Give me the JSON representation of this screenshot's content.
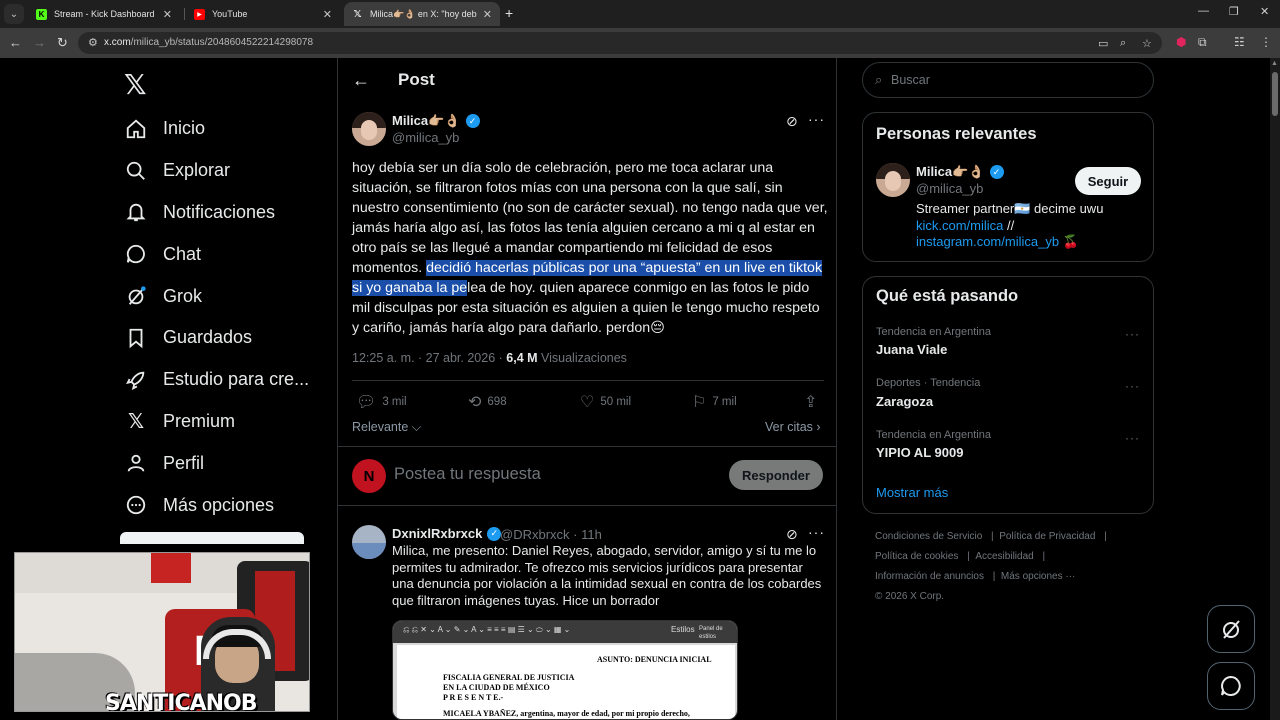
{
  "browser": {
    "tabs": [
      {
        "label": "Stream - Kick Dashboard",
        "icon": "kick-icon"
      },
      {
        "label": "YouTube",
        "icon": "youtube-icon"
      },
      {
        "label": "Milica👉🏼👌🏼 en X: \"hoy debía s",
        "icon": "x-icon"
      }
    ],
    "url_domain": "x.com",
    "url_path": "/milica_yb/status/2048604522214298078"
  },
  "sidebar": {
    "items": [
      {
        "label": "Inicio",
        "icon": "home-icon"
      },
      {
        "label": "Explorar",
        "icon": "search-icon"
      },
      {
        "label": "Notificaciones",
        "icon": "bell-icon"
      },
      {
        "label": "Chat",
        "icon": "chat-icon"
      },
      {
        "label": "Grok",
        "icon": "grok-icon"
      },
      {
        "label": "Guardados",
        "icon": "bookmark-icon"
      },
      {
        "label": "Estudio para cre...",
        "icon": "rocket-icon"
      },
      {
        "label": "Premium",
        "icon": "x-icon"
      },
      {
        "label": "Perfil",
        "icon": "person-icon"
      },
      {
        "label": "Más opciones",
        "icon": "more-circle-icon"
      }
    ]
  },
  "webcam": {
    "brand": "SANTICANOB"
  },
  "post": {
    "header": "Post",
    "author": {
      "name": "Milica👉🏼👌🏼",
      "handle": "@milica_yb"
    },
    "text_before": "hoy debía ser un día solo de celebración, pero me toca aclarar una situación, se filtraron fotos mías con una persona con la que salí, sin nuestro consentimiento (no son de carácter sexual). no tengo nada que ver,  jamás haría algo así, las fotos las tenía alguien cercano a mi q al estar en otro país se las llegué a mandar compartiendo mi felicidad de esos momentos. ",
    "text_highlight": " decidió hacerlas públicas por una “apuesta” en un live en tiktok si yo ganaba la pe",
    "text_after": "lea de hoy. quien aparece conmigo en las fotos le pido mil disculpas por esta situación es alguien a quien le tengo mucho respeto y cariño,  jamás haría algo para dañarlo. perdon😔",
    "time": "12:25 a. m. · 27 abr. 2026 · ",
    "views_count": "6,4 M",
    "views_label": " Visualizaciones",
    "replies": "3 mil",
    "reposts": "698",
    "likes": "50 mil",
    "bookmarks": "7 mil",
    "sort_label": "Relevante",
    "quotes_label": "Ver citas",
    "reply_placeholder": "Postea tu respuesta",
    "reply_button": "Responder"
  },
  "comment": {
    "name": "DxnixlRxbrxck",
    "handle": "@DRxbrxck · 11h",
    "text": "Milica, me presento: Daniel Reyes, abogado, servidor, amigo y sí tu me lo permites tu admirador. Te ofrezco mis servicios jurídicos para presentar una denuncia por violación a la intimidad sexual en contra de los cobardes que filtraron imágenes tuyas. Hice un borrador",
    "doc": {
      "toolbar_a": "Estilos",
      "toolbar_b": "Panel de estilos",
      "subject": "ASUNTO: DENUNCIA INICIAL",
      "line1": "FISCALIA GENERAL DE JUSTICIA",
      "line2": "EN LA CIUDAD DE MÉXICO",
      "line3": "P R E S E N T E.-",
      "line4": "MICAELA YBAÑEZ, argentina, mayor de edad, por mi propio derecho,"
    }
  },
  "right": {
    "search_placeholder": "Buscar",
    "relevant_title": "Personas relevantes",
    "person": {
      "name": "Milica👉🏼👌🏼",
      "handle": "@milica_yb",
      "follow": "Seguir",
      "bio_line1": "Streamer partner🇦🇷 decime uwu",
      "bio_link1": "kick.com/milica",
      "bio_sep": " //",
      "bio_link2": "instagram.com/milica_yb",
      "bio_emoji": " 🍒"
    },
    "trends_title": "Qué está pasando",
    "trends": [
      {
        "category": "Tendencia en Argentina",
        "name": "Juana Viale"
      },
      {
        "category": "Deportes · Tendencia",
        "name": "Zaragoza"
      },
      {
        "category": "Tendencia en Argentina",
        "name": "YIPIO AL 9009"
      }
    ],
    "show_more": "Mostrar más",
    "footer": {
      "terms": "Condiciones de Servicio",
      "privacy": "Política de Privacidad",
      "cookies": "Política de cookies",
      "accessibility": "Accesibilidad",
      "ads": "Información de anuncios",
      "more": "Más opciones ···",
      "copyright": "© 2026 X Corp."
    }
  },
  "colors": {
    "accent": "#1d9bf0",
    "highlight": "#1a4ea8",
    "background": "#000000"
  }
}
